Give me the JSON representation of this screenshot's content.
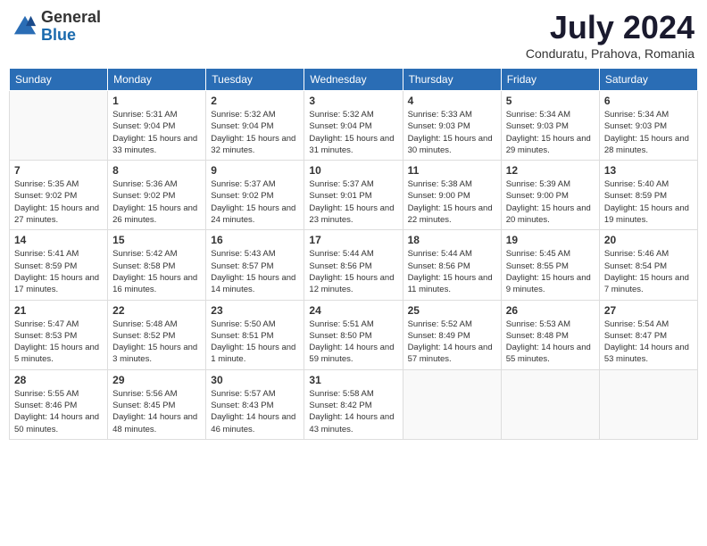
{
  "header": {
    "logo_general": "General",
    "logo_blue": "Blue",
    "month_title": "July 2024",
    "subtitle": "Conduratu, Prahova, Romania"
  },
  "weekdays": [
    "Sunday",
    "Monday",
    "Tuesday",
    "Wednesday",
    "Thursday",
    "Friday",
    "Saturday"
  ],
  "weeks": [
    [
      {
        "day": "",
        "empty": true
      },
      {
        "day": "1",
        "sunrise": "Sunrise: 5:31 AM",
        "sunset": "Sunset: 9:04 PM",
        "daylight": "Daylight: 15 hours and 33 minutes."
      },
      {
        "day": "2",
        "sunrise": "Sunrise: 5:32 AM",
        "sunset": "Sunset: 9:04 PM",
        "daylight": "Daylight: 15 hours and 32 minutes."
      },
      {
        "day": "3",
        "sunrise": "Sunrise: 5:32 AM",
        "sunset": "Sunset: 9:04 PM",
        "daylight": "Daylight: 15 hours and 31 minutes."
      },
      {
        "day": "4",
        "sunrise": "Sunrise: 5:33 AM",
        "sunset": "Sunset: 9:03 PM",
        "daylight": "Daylight: 15 hours and 30 minutes."
      },
      {
        "day": "5",
        "sunrise": "Sunrise: 5:34 AM",
        "sunset": "Sunset: 9:03 PM",
        "daylight": "Daylight: 15 hours and 29 minutes."
      },
      {
        "day": "6",
        "sunrise": "Sunrise: 5:34 AM",
        "sunset": "Sunset: 9:03 PM",
        "daylight": "Daylight: 15 hours and 28 minutes."
      }
    ],
    [
      {
        "day": "7",
        "sunrise": "Sunrise: 5:35 AM",
        "sunset": "Sunset: 9:02 PM",
        "daylight": "Daylight: 15 hours and 27 minutes."
      },
      {
        "day": "8",
        "sunrise": "Sunrise: 5:36 AM",
        "sunset": "Sunset: 9:02 PM",
        "daylight": "Daylight: 15 hours and 26 minutes."
      },
      {
        "day": "9",
        "sunrise": "Sunrise: 5:37 AM",
        "sunset": "Sunset: 9:02 PM",
        "daylight": "Daylight: 15 hours and 24 minutes."
      },
      {
        "day": "10",
        "sunrise": "Sunrise: 5:37 AM",
        "sunset": "Sunset: 9:01 PM",
        "daylight": "Daylight: 15 hours and 23 minutes."
      },
      {
        "day": "11",
        "sunrise": "Sunrise: 5:38 AM",
        "sunset": "Sunset: 9:00 PM",
        "daylight": "Daylight: 15 hours and 22 minutes."
      },
      {
        "day": "12",
        "sunrise": "Sunrise: 5:39 AM",
        "sunset": "Sunset: 9:00 PM",
        "daylight": "Daylight: 15 hours and 20 minutes."
      },
      {
        "day": "13",
        "sunrise": "Sunrise: 5:40 AM",
        "sunset": "Sunset: 8:59 PM",
        "daylight": "Daylight: 15 hours and 19 minutes."
      }
    ],
    [
      {
        "day": "14",
        "sunrise": "Sunrise: 5:41 AM",
        "sunset": "Sunset: 8:59 PM",
        "daylight": "Daylight: 15 hours and 17 minutes."
      },
      {
        "day": "15",
        "sunrise": "Sunrise: 5:42 AM",
        "sunset": "Sunset: 8:58 PM",
        "daylight": "Daylight: 15 hours and 16 minutes."
      },
      {
        "day": "16",
        "sunrise": "Sunrise: 5:43 AM",
        "sunset": "Sunset: 8:57 PM",
        "daylight": "Daylight: 15 hours and 14 minutes."
      },
      {
        "day": "17",
        "sunrise": "Sunrise: 5:44 AM",
        "sunset": "Sunset: 8:56 PM",
        "daylight": "Daylight: 15 hours and 12 minutes."
      },
      {
        "day": "18",
        "sunrise": "Sunrise: 5:44 AM",
        "sunset": "Sunset: 8:56 PM",
        "daylight": "Daylight: 15 hours and 11 minutes."
      },
      {
        "day": "19",
        "sunrise": "Sunrise: 5:45 AM",
        "sunset": "Sunset: 8:55 PM",
        "daylight": "Daylight: 15 hours and 9 minutes."
      },
      {
        "day": "20",
        "sunrise": "Sunrise: 5:46 AM",
        "sunset": "Sunset: 8:54 PM",
        "daylight": "Daylight: 15 hours and 7 minutes."
      }
    ],
    [
      {
        "day": "21",
        "sunrise": "Sunrise: 5:47 AM",
        "sunset": "Sunset: 8:53 PM",
        "daylight": "Daylight: 15 hours and 5 minutes."
      },
      {
        "day": "22",
        "sunrise": "Sunrise: 5:48 AM",
        "sunset": "Sunset: 8:52 PM",
        "daylight": "Daylight: 15 hours and 3 minutes."
      },
      {
        "day": "23",
        "sunrise": "Sunrise: 5:50 AM",
        "sunset": "Sunset: 8:51 PM",
        "daylight": "Daylight: 15 hours and 1 minute."
      },
      {
        "day": "24",
        "sunrise": "Sunrise: 5:51 AM",
        "sunset": "Sunset: 8:50 PM",
        "daylight": "Daylight: 14 hours and 59 minutes."
      },
      {
        "day": "25",
        "sunrise": "Sunrise: 5:52 AM",
        "sunset": "Sunset: 8:49 PM",
        "daylight": "Daylight: 14 hours and 57 minutes."
      },
      {
        "day": "26",
        "sunrise": "Sunrise: 5:53 AM",
        "sunset": "Sunset: 8:48 PM",
        "daylight": "Daylight: 14 hours and 55 minutes."
      },
      {
        "day": "27",
        "sunrise": "Sunrise: 5:54 AM",
        "sunset": "Sunset: 8:47 PM",
        "daylight": "Daylight: 14 hours and 53 minutes."
      }
    ],
    [
      {
        "day": "28",
        "sunrise": "Sunrise: 5:55 AM",
        "sunset": "Sunset: 8:46 PM",
        "daylight": "Daylight: 14 hours and 50 minutes."
      },
      {
        "day": "29",
        "sunrise": "Sunrise: 5:56 AM",
        "sunset": "Sunset: 8:45 PM",
        "daylight": "Daylight: 14 hours and 48 minutes."
      },
      {
        "day": "30",
        "sunrise": "Sunrise: 5:57 AM",
        "sunset": "Sunset: 8:43 PM",
        "daylight": "Daylight: 14 hours and 46 minutes."
      },
      {
        "day": "31",
        "sunrise": "Sunrise: 5:58 AM",
        "sunset": "Sunset: 8:42 PM",
        "daylight": "Daylight: 14 hours and 43 minutes."
      },
      {
        "day": "",
        "empty": true
      },
      {
        "day": "",
        "empty": true
      },
      {
        "day": "",
        "empty": true
      }
    ]
  ]
}
